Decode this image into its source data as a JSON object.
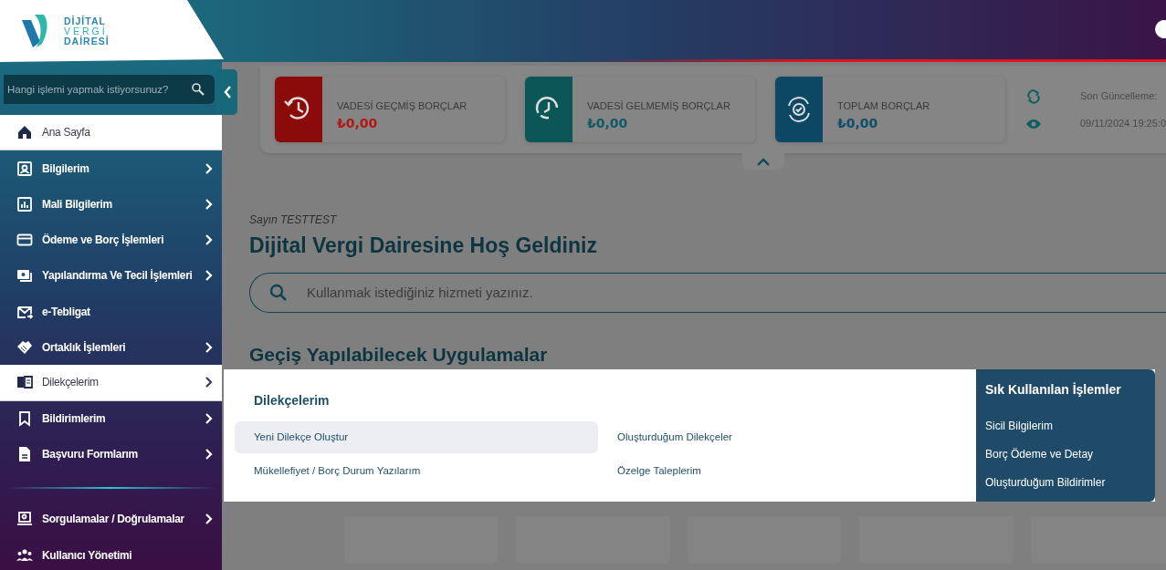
{
  "header": {
    "logo_lines": [
      "DİJİTAL",
      "VERGİ",
      "DAİRESİ"
    ]
  },
  "sidebar": {
    "search": {
      "placeholder": "Hangi işlemi yapmak istiyorsunuz?"
    },
    "items": [
      {
        "label": "Ana Sayfa",
        "selected": true,
        "has_submenu": false
      },
      {
        "label": "Bilgilerim",
        "selected": false,
        "has_submenu": true
      },
      {
        "label": "Mali Bilgilerim",
        "selected": false,
        "has_submenu": true
      },
      {
        "label": "Ödeme ve Borç İşlemleri",
        "selected": false,
        "has_submenu": true
      },
      {
        "label": "Yapılandırma Ve Tecil İşlemleri",
        "selected": false,
        "has_submenu": true
      },
      {
        "label": "e-Tebligat",
        "selected": false,
        "has_submenu": false
      },
      {
        "label": "Ortaklık İşlemleri",
        "selected": false,
        "has_submenu": true
      },
      {
        "label": "Dilekçelerim",
        "selected": true,
        "has_submenu": true
      },
      {
        "label": "Bildirimlerim",
        "selected": false,
        "has_submenu": true
      },
      {
        "label": "Başvuru Formlarım",
        "selected": false,
        "has_submenu": true
      }
    ],
    "bottom_items": [
      {
        "label": "Sorgulamalar / Doğrulamalar",
        "selected": false,
        "has_submenu": true
      },
      {
        "label": "Kullanıcı Yönetimi",
        "selected": false,
        "has_submenu": false
      }
    ]
  },
  "summary": {
    "cards": [
      {
        "kind": "overdue",
        "title": "VADESİ GEÇMİŞ BORÇLAR",
        "amount": "₺0,00"
      },
      {
        "kind": "upcoming",
        "title": "VADESİ GELMEMİŞ BORÇLAR",
        "amount": "₺0,00"
      },
      {
        "kind": "total",
        "title": "TOPLAM BORÇLAR",
        "amount": "₺0,00"
      }
    ],
    "update_label": "Son Güncelleme:",
    "update_time": "09/11/2024 19:25:0",
    "expanded": true
  },
  "welcome": {
    "greeting": "Sayın TESTTEST",
    "title": "Dijital Vergi Dairesine Hoş Geldiniz",
    "search": {
      "placeholder": "Kullanmak istediğiniz hizmeti yazınız."
    },
    "apps_title": "Geçiş Yapılabilecek Uygulamalar"
  },
  "menu_panel": {
    "title": "Dilekçelerim",
    "links": [
      {
        "label": "Yeni Dilekçe Oluştur",
        "selected": true
      },
      {
        "label": "Oluşturduğum Dilekçeler",
        "selected": false
      },
      {
        "label": "Mükellefiyet / Borç Durum Yazılarım",
        "selected": false
      },
      {
        "label": "Özelge Taleplerim",
        "selected": false
      }
    ],
    "frequent_title": "Sık Kullanılan İşlemler",
    "frequent_links": [
      "Sicil Bilgilerim",
      "Borç Ödeme ve Detay",
      "Oluşturduğum Bildirimler"
    ]
  }
}
